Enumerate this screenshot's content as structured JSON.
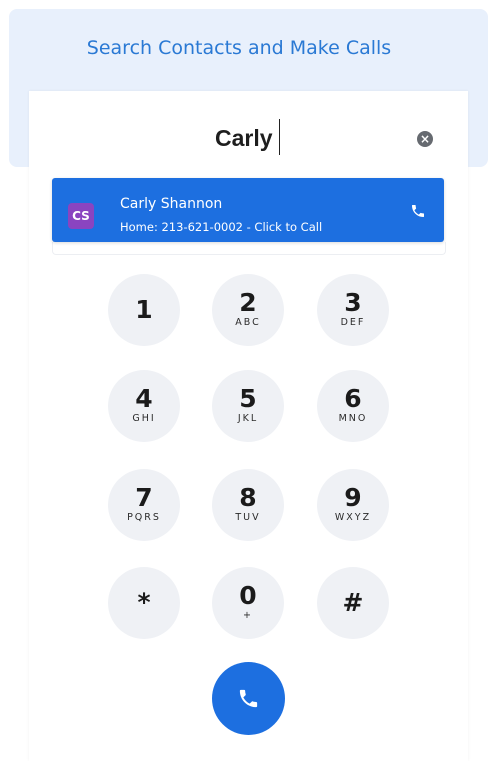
{
  "header": {
    "title": "Search Contacts and Make Calls"
  },
  "search": {
    "value": "Carly"
  },
  "result": {
    "initials": "CS",
    "name": "Carly Shannon",
    "detail": "Home: 213-621-0002 - Click to Call"
  },
  "keys": [
    {
      "digit": "1",
      "letters": ""
    },
    {
      "digit": "2",
      "letters": "ABC"
    },
    {
      "digit": "3",
      "letters": "DEF"
    },
    {
      "digit": "4",
      "letters": "GHI"
    },
    {
      "digit": "5",
      "letters": "JKL"
    },
    {
      "digit": "6",
      "letters": "MNO"
    },
    {
      "digit": "7",
      "letters": "PQRS"
    },
    {
      "digit": "8",
      "letters": "TUV"
    },
    {
      "digit": "9",
      "letters": "WXYZ"
    },
    {
      "digit": "*",
      "letters": ""
    },
    {
      "digit": "0",
      "letters": "+"
    },
    {
      "digit": "#",
      "letters": ""
    }
  ],
  "colors": {
    "accent": "#1d6fe0",
    "avatar": "#8a44c0",
    "banner_bg": "#e8f0fc",
    "key_bg": "#eff1f5"
  },
  "icons": {
    "clear": "close-circle-icon",
    "row_call": "phone-icon",
    "call": "phone-icon"
  }
}
